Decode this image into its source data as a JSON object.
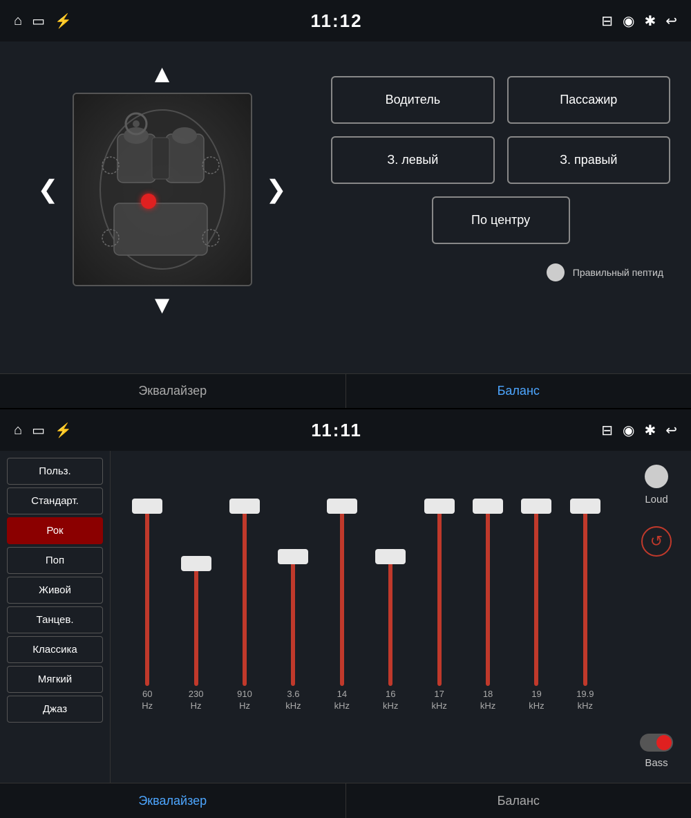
{
  "top": {
    "statusBar": {
      "time": "11:12",
      "leftIcons": [
        "home-icon",
        "screen-icon",
        "usb-icon"
      ],
      "rightIcons": [
        "cast-icon",
        "location-icon",
        "bluetooth-icon",
        "back-icon"
      ]
    },
    "upArrow": "▲",
    "downArrow": "▼",
    "leftArrow": "❮",
    "rightArrow": "❯",
    "buttons": {
      "driver": "Водитель",
      "passenger": "Пассажир",
      "rearLeft": "З. левый",
      "rearRight": "З. правый",
      "center": "По центру"
    },
    "peptideLabel": "Правильный пептид",
    "tabs": [
      {
        "label": "Эквалайзер",
        "active": false
      },
      {
        "label": "Баланс",
        "active": true
      }
    ]
  },
  "bottom": {
    "statusBar": {
      "time": "11:11",
      "leftIcons": [
        "home-icon",
        "screen-icon",
        "usb-icon"
      ],
      "rightIcons": [
        "cast-icon",
        "location-icon",
        "bluetooth-icon",
        "back-icon"
      ]
    },
    "presets": [
      {
        "label": "Польз.",
        "active": false
      },
      {
        "label": "Стандарт.",
        "active": false
      },
      {
        "label": "Рок",
        "active": true
      },
      {
        "label": "Поп",
        "active": false
      },
      {
        "label": "Живой",
        "active": false
      },
      {
        "label": "Танцев.",
        "active": false
      },
      {
        "label": "Классика",
        "active": false
      },
      {
        "label": "Мягкий",
        "active": false
      },
      {
        "label": "Джаз",
        "active": false
      }
    ],
    "sliders": [
      {
        "freq": "60",
        "unit": "Hz",
        "heightPct": 100
      },
      {
        "freq": "230",
        "unit": "Hz",
        "heightPct": 68
      },
      {
        "freq": "910",
        "unit": "Hz",
        "heightPct": 100
      },
      {
        "freq": "3.6",
        "unit": "kHz",
        "heightPct": 72
      },
      {
        "freq": "14",
        "unit": "kHz",
        "heightPct": 100
      },
      {
        "freq": "16",
        "unit": "kHz",
        "heightPct": 72
      },
      {
        "freq": "17",
        "unit": "kHz",
        "heightPct": 100
      },
      {
        "freq": "18",
        "unit": "kHz",
        "heightPct": 100
      },
      {
        "freq": "19",
        "unit": "kHz",
        "heightPct": 100
      },
      {
        "freq": "19.9",
        "unit": "kHz",
        "heightPct": 100
      }
    ],
    "loudLabel": "Loud",
    "bassLabel": "Bass",
    "resetTitle": "↺",
    "tabs": [
      {
        "label": "Эквалайзер",
        "active": true
      },
      {
        "label": "Баланс",
        "active": false
      }
    ]
  }
}
